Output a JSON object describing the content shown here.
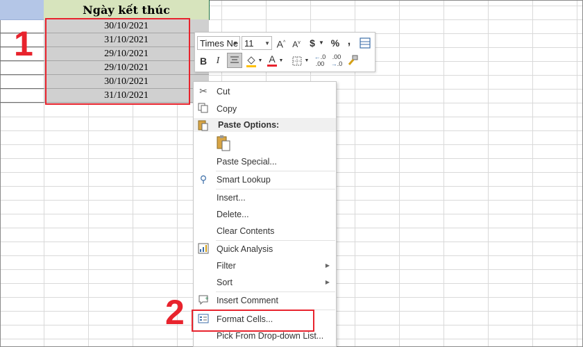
{
  "sheet": {
    "header_title": "Ngày kết thúc",
    "dates": [
      "30/10/2021",
      "31/10/2021",
      "29/10/2021",
      "29/10/2021",
      "30/10/2021",
      "31/10/2021"
    ]
  },
  "callouts": {
    "step1": "1",
    "step2": "2"
  },
  "mini_toolbar": {
    "font_name": "Times Ne",
    "font_size": "11",
    "grow_font": "A",
    "shrink_font": "A",
    "currency": "$",
    "percent": "%",
    "comma": ",",
    "bold": "B",
    "italic": "I",
    "font_color_letter": "A",
    "increase_decimal": ".00",
    "decrease_decimal": ".00",
    "accent_colors": {
      "font_color": "#e8232d",
      "fill_color": "#ffc000"
    }
  },
  "context_menu": {
    "cut": "Cut",
    "copy": "Copy",
    "paste_options": "Paste Options:",
    "paste_special": "Paste Special...",
    "smart_lookup": "Smart Lookup",
    "insert": "Insert...",
    "delete": "Delete...",
    "clear_contents": "Clear Contents",
    "quick_analysis": "Quick Analysis",
    "filter": "Filter",
    "sort": "Sort",
    "insert_comment": "Insert Comment",
    "format_cells": "Format Cells...",
    "pick_from_list": "Pick From Drop-down List..."
  },
  "colors": {
    "highlight": "#e8232d",
    "excel_green": "#217346",
    "header_a_bg": "#b4c6e7",
    "header_b_bg": "#d7e4bd",
    "selected_cell_bg": "#d0d0d0"
  }
}
